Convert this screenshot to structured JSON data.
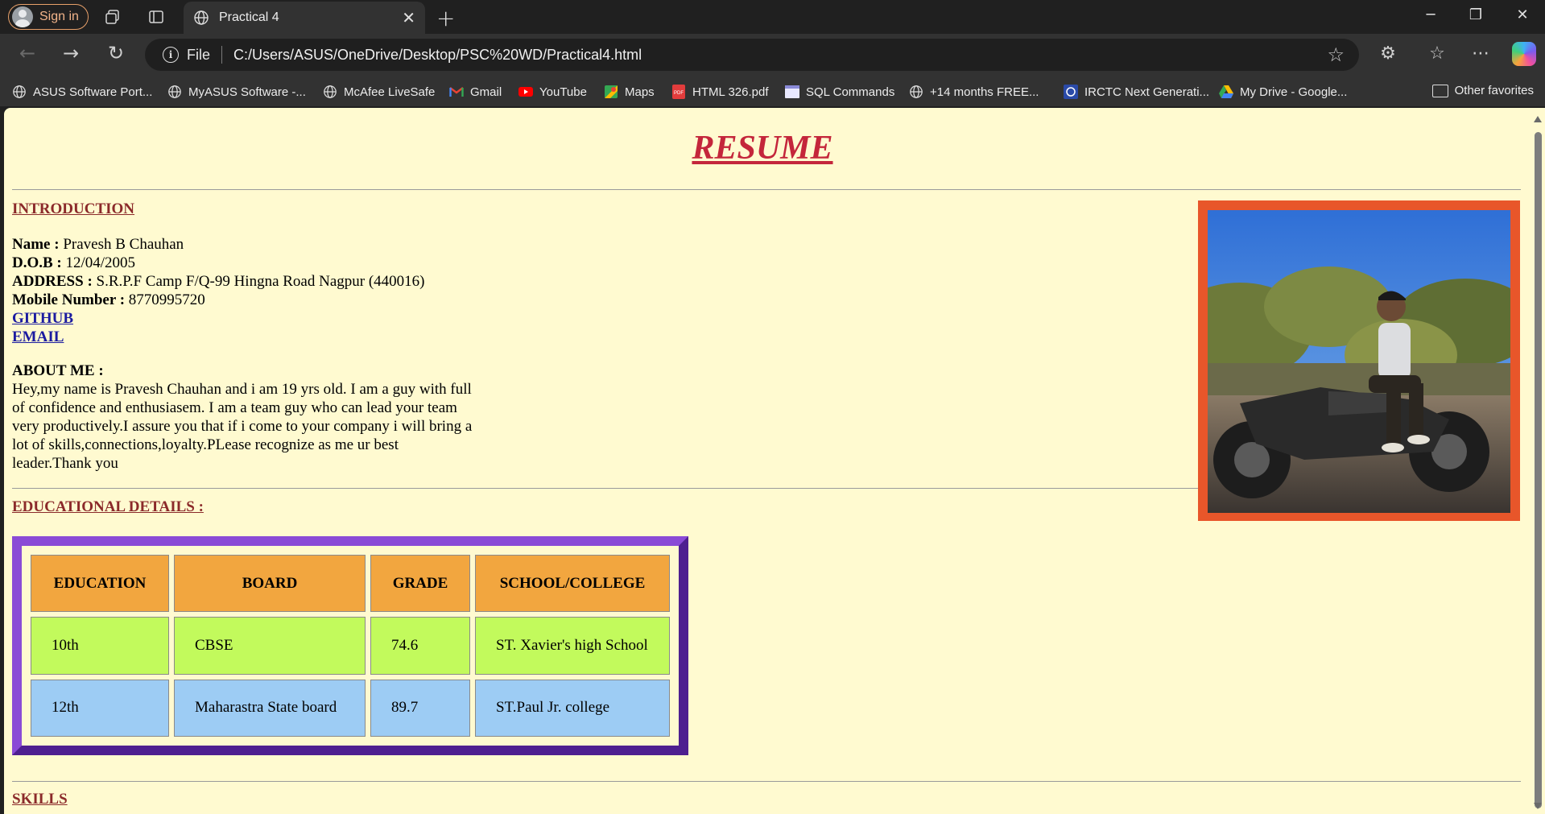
{
  "browser": {
    "signin_label": "Sign in",
    "tab_title": "Practical 4",
    "address_scheme_label": "File",
    "address_url": "C:/Users/ASUS/OneDrive/Desktop/PSC%20WD/Practical4.html",
    "bookmarks": [
      {
        "label": "ASUS Software Port...",
        "icon": "globe-icon"
      },
      {
        "label": "MyASUS Software -...",
        "icon": "globe-icon"
      },
      {
        "label": "McAfee LiveSafe",
        "icon": "globe-icon"
      },
      {
        "label": "Gmail",
        "icon": "gmail-icon"
      },
      {
        "label": "YouTube",
        "icon": "youtube-icon"
      },
      {
        "label": "Maps",
        "icon": "maps-icon"
      },
      {
        "label": "HTML 326.pdf",
        "icon": "pdf-icon"
      },
      {
        "label": "SQL Commands",
        "icon": "page-icon"
      },
      {
        "label": "+14 months FREE...",
        "icon": "globe-icon"
      },
      {
        "label": "IRCTC Next Generati...",
        "icon": "irctc-icon"
      },
      {
        "label": "My Drive - Google...",
        "icon": "drive-icon"
      }
    ],
    "other_favorites": "Other favorites"
  },
  "page": {
    "title": "RESUME",
    "intro_heading": "INTRODUCTION",
    "name_label": "Name :",
    "name_value": "Pravesh B Chauhan",
    "dob_label": "D.O.B :",
    "dob_value": "12/04/2005",
    "address_label": "ADDRESS :",
    "address_value": "S.R.P.F Camp F/Q-99 Hingna Road Nagpur (440016)",
    "mobile_label": "Mobile Number :",
    "mobile_value": "8770995720",
    "github_link": "GITHUB",
    "email_link": "EMAIL",
    "about_heading": "ABOUT ME :",
    "about_text": "Hey,my name is Pravesh Chauhan and i am 19 yrs old. I am a guy with full of confidence and enthusiasem. I am a team guy who can lead your team very productively.I assure you that if i come to your company i will bring a lot of skills,connections,loyalty.PLease recognize as me ur best leader.Thank you",
    "edu_heading": "EDUCATIONAL DETAILS :",
    "edu_table": {
      "headers": [
        "EDUCATION",
        "BOARD",
        "GRADE",
        "SCHOOL/COLLEGE"
      ],
      "rows": [
        [
          "10th",
          "CBSE",
          "74.6",
          "ST. Xavier's high School"
        ],
        [
          "12th",
          "Maharastra State board",
          "89.7",
          "ST.Paul Jr. college"
        ]
      ]
    },
    "skills_heading": "SKILLS"
  },
  "colors": {
    "page_bg": "#fffad0",
    "title_red": "#c4263b",
    "heading_maroon": "#8b2a2a",
    "photo_border": "#e8562a",
    "table_border": "#6a2fb8",
    "header_orange": "#f2a63f",
    "row1_green": "#c2fa5c",
    "row2_blue": "#9dccf4"
  }
}
